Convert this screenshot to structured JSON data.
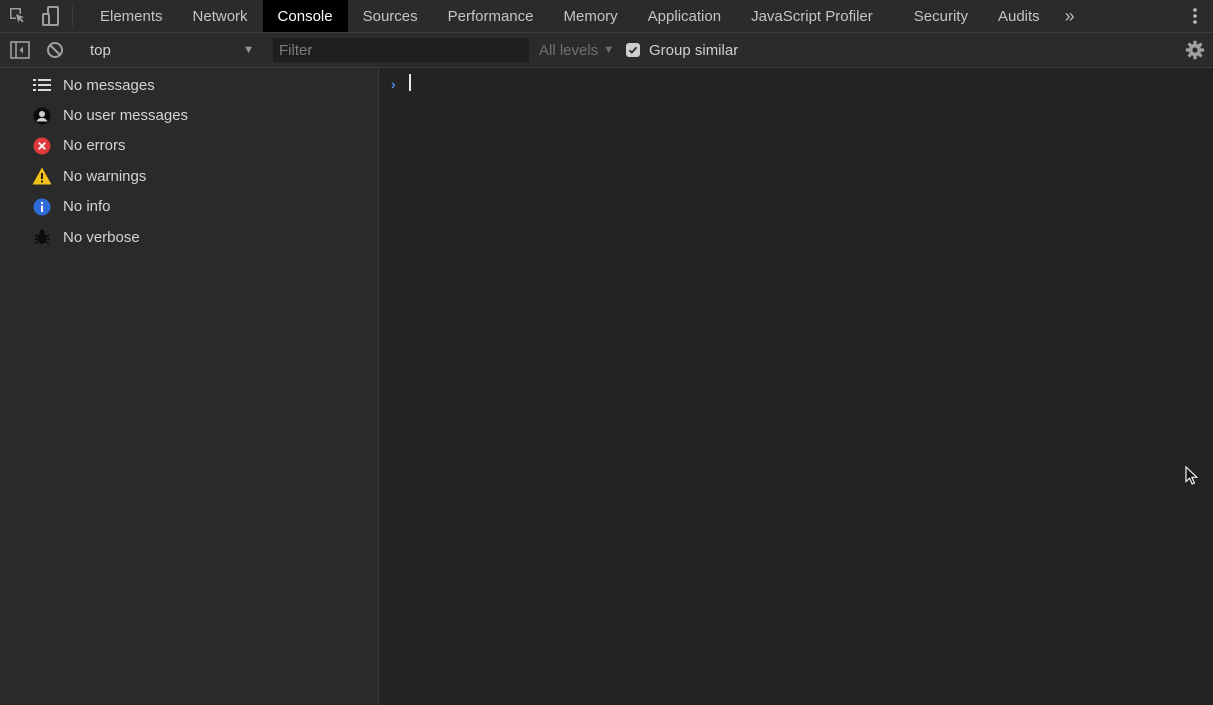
{
  "tabs": [
    {
      "label": "Elements"
    },
    {
      "label": "Network"
    },
    {
      "label": "Console"
    },
    {
      "label": "Sources"
    },
    {
      "label": "Performance"
    },
    {
      "label": "Memory"
    },
    {
      "label": "Application"
    },
    {
      "label": "JavaScript Profiler"
    },
    {
      "label": "Security"
    },
    {
      "label": "Audits"
    }
  ],
  "active_tab": "Console",
  "more_tabs_icon": "»",
  "toolbar": {
    "context": "top",
    "filter_placeholder": "Filter",
    "levels_label": "All levels",
    "group_similar_label": "Group similar",
    "group_similar_checked": true
  },
  "sidebar": {
    "items": [
      {
        "label": "No messages",
        "icon": "list-icon"
      },
      {
        "label": "No user messages",
        "icon": "user-icon"
      },
      {
        "label": "No errors",
        "icon": "error-icon",
        "color": "#e0393c"
      },
      {
        "label": "No warnings",
        "icon": "warning-icon",
        "color": "#f2c11b"
      },
      {
        "label": "No info",
        "icon": "info-icon",
        "color": "#2f6bd6"
      },
      {
        "label": "No verbose",
        "icon": "bug-icon"
      }
    ]
  },
  "console": {
    "prompt_symbol": "›",
    "accent_color": "#4b8ff0"
  }
}
